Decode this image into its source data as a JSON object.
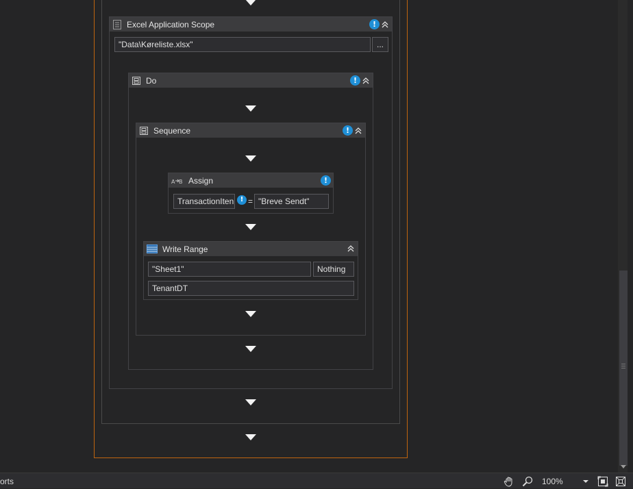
{
  "excel_scope": {
    "title": "Excel Application Scope",
    "path_value": "\"Data\\Køreliste.xlsx\"",
    "browse_label": "..."
  },
  "do_block": {
    "title": "Do"
  },
  "sequence": {
    "title": "Sequence"
  },
  "assign": {
    "title": "Assign",
    "left_value": "TransactionIten",
    "equals": "=",
    "right_value": "\"Breve Sendt\""
  },
  "write_range": {
    "title": "Write Range",
    "sheet_value": "\"Sheet1\"",
    "range_value": "Nothing",
    "datatable_value": "TenantDT"
  },
  "warning_glyph": "!",
  "statusbar": {
    "left_text": "orts",
    "zoom": "100%"
  },
  "icons": [
    "hand-pan-icon",
    "magnifier-icon",
    "fit-screen-icon",
    "overview-icon",
    "collapse-chevron-icon",
    "excel-scope-icon",
    "sequence-icon",
    "assign-icon",
    "table-icon",
    "warning-icon"
  ],
  "colors": {
    "canvas": "#252526",
    "outline_active": "#c0650f",
    "outline": "#4a4a4a",
    "header": "#3c3c3e",
    "warning": "#1f8fd6"
  }
}
